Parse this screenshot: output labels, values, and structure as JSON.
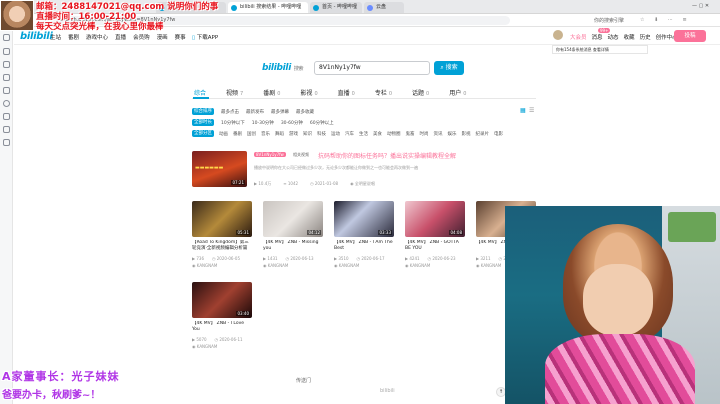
{
  "browser": {
    "tabs": [
      {
        "label": "爱给网",
        "active": false
      },
      {
        "label": "bilibili 搜索结果 - 哔哩哔哩",
        "active": true
      },
      {
        "label": "首页 - 哔哩哔哩",
        "active": false
      },
      {
        "label": "云盘",
        "active": false
      }
    ],
    "url": "search.bilibili.com/all?keyword=8V1nNy1y7fw",
    "right_label": "你的搜索引擎"
  },
  "overlay": {
    "email_line": "邮箱：2488147021@qq.com 说明你们的事",
    "hours_line": "直播时间：16:00-21:00",
    "tagline": "每天交点突光棒，在我心里你最棒",
    "bottom_line1": "A家董事长：光子妹妹",
    "bottom_line2": "爸要办卡，秋刷爹~！"
  },
  "topnav": {
    "items": [
      "主站",
      "番剧",
      "游戏中心",
      "直播",
      "会员购",
      "漫画",
      "赛事"
    ],
    "download": "下载APP",
    "right_items": [
      "大会员",
      "消息",
      "动态",
      "收藏",
      "历史",
      "创作中心"
    ],
    "upload_button": "投稿",
    "badge_count": "99+",
    "notice": "你有154条系统消息 查看详情"
  },
  "search": {
    "logo": "bilibili",
    "logo_suffix": "搜索",
    "query": "8V1nNy1y7fw",
    "button": "搜索"
  },
  "categories": [
    {
      "label": "综合",
      "count": "",
      "active": true
    },
    {
      "label": "视频",
      "count": "7",
      "active": false
    },
    {
      "label": "番剧",
      "count": "0",
      "active": false
    },
    {
      "label": "影视",
      "count": "0",
      "active": false
    },
    {
      "label": "直播",
      "count": "0",
      "active": false
    },
    {
      "label": "专栏",
      "count": "0",
      "active": false
    },
    {
      "label": "话题",
      "count": "0",
      "active": false
    },
    {
      "label": "用户",
      "count": "0",
      "active": false
    }
  ],
  "filters": {
    "sort": {
      "pill": "综合排序",
      "options": [
        "最多点击",
        "最新发布",
        "最多弹幕",
        "最多收藏"
      ]
    },
    "duration": {
      "pill": "全部时长",
      "options": [
        "10分钟以下",
        "10-30分钟",
        "30-60分钟",
        "60分钟以上"
      ]
    },
    "zone": {
      "pill": "全部分区",
      "options": [
        "动画",
        "番剧",
        "国创",
        "音乐",
        "舞蹈",
        "游戏",
        "知识",
        "科技",
        "运动",
        "汽车",
        "生活",
        "美食",
        "动物圈",
        "鬼畜",
        "时尚",
        "资讯",
        "娱乐",
        "影视",
        "纪录片",
        "电影",
        "电视剧"
      ],
      "more": "更多"
    }
  },
  "featured": {
    "tag": "8V1nNy1y7fw",
    "tag2": "相关视频",
    "title": "抗码帮助你的图标任务吗？播出说实操编辑教程全解",
    "desc": "播放中说明你在大公司已经做过多少次，无论多少次都能让你做到之一也可能会再次做到一遍",
    "duration": "07:21",
    "views": "10.4万",
    "danmaku": "1042",
    "date": "2021-01-08",
    "uploader": "全明星说唱"
  },
  "videos": [
    {
      "title": "【Road To Kingdom】第三轮竞演·全新视频编辑分析篇",
      "duration": "05:31",
      "views": "736",
      "date": "2020-06-05",
      "up": "KANGNAM"
    },
    {
      "title": "【4K MV】 ZNB - Missing you",
      "duration": "04:12",
      "views": "1431",
      "date": "2020-06-13",
      "up": "KANGNAM"
    },
    {
      "title": "【4K MV】 ZNB - I Am The Best",
      "duration": "03:33",
      "views": "3510",
      "date": "2020-06-17",
      "up": "KANGNAM"
    },
    {
      "title": "【4K MV】 ZNB - GOTTA BE YOU",
      "duration": "04:08",
      "views": "4241",
      "date": "2020-06-23",
      "up": "KANGNAM"
    },
    {
      "title": "【4K MV】 ZNB - Love",
      "duration": "03:48",
      "views": "3211",
      "date": "2020-06-27",
      "up": "KANGNAM"
    },
    {
      "title": "【4K MV】 ZNB - I Love You",
      "duration": "03:40",
      "views": "5070",
      "date": "2020-06-11",
      "up": "KANGNAM"
    }
  ],
  "footer": {
    "links": [
      "传送门",
      "bilibili"
    ]
  },
  "colors": {
    "brand": "#00a1d6",
    "pink": "#fb7299"
  }
}
